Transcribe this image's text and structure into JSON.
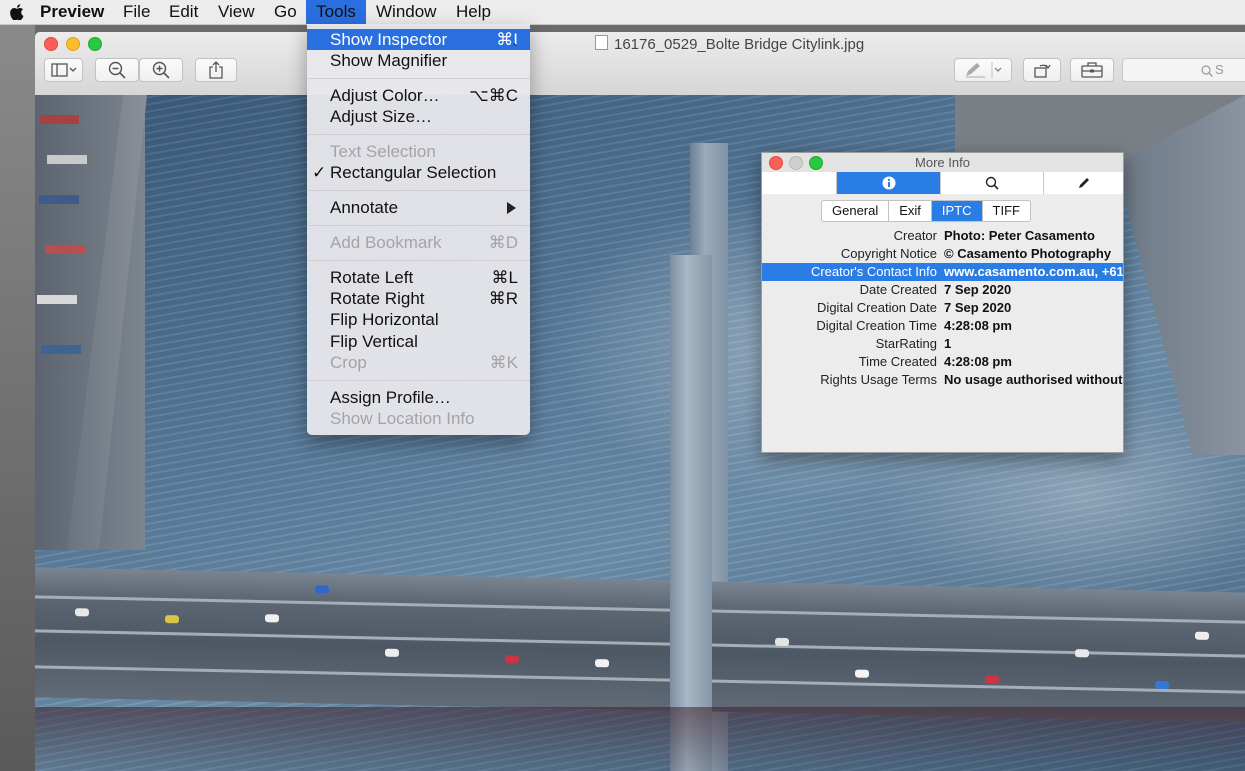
{
  "menubar": {
    "app": "Preview",
    "items": [
      "File",
      "Edit",
      "View",
      "Go",
      "Tools",
      "Window",
      "Help"
    ]
  },
  "window": {
    "title": "16176_0529_Bolte Bridge Citylink.jpg",
    "search_placeholder": "S"
  },
  "tools_menu": {
    "items": [
      {
        "label": "Show Inspector",
        "shortcut": "⌘I",
        "state": "highlighted"
      },
      {
        "label": "Show Magnifier",
        "shortcut": "`",
        "state": "enabled"
      },
      {
        "label": "Adjust Color…",
        "shortcut": "⌥⌘C",
        "state": "enabled"
      },
      {
        "label": "Adjust Size…",
        "shortcut": "",
        "state": "enabled"
      },
      {
        "label": "Text Selection",
        "shortcut": "",
        "state": "disabled"
      },
      {
        "label": "Rectangular Selection",
        "shortcut": "",
        "state": "checked"
      },
      {
        "label": "Annotate",
        "shortcut": "",
        "state": "submenu"
      },
      {
        "label": "Add Bookmark",
        "shortcut": "⌘D",
        "state": "disabled"
      },
      {
        "label": "Rotate Left",
        "shortcut": "⌘L",
        "state": "enabled"
      },
      {
        "label": "Rotate Right",
        "shortcut": "⌘R",
        "state": "enabled"
      },
      {
        "label": "Flip Horizontal",
        "shortcut": "",
        "state": "enabled"
      },
      {
        "label": "Flip Vertical",
        "shortcut": "",
        "state": "enabled"
      },
      {
        "label": "Crop",
        "shortcut": "⌘K",
        "state": "disabled"
      },
      {
        "label": "Assign Profile…",
        "shortcut": "",
        "state": "enabled"
      },
      {
        "label": "Show Location Info",
        "shortcut": "",
        "state": "disabled"
      }
    ],
    "checkmark": "✓"
  },
  "more_info": {
    "title": "More Info",
    "segments": [
      "info-icon",
      "search-icon",
      "pencil-icon"
    ],
    "tabs": [
      "General",
      "Exif",
      "IPTC",
      "TIFF"
    ],
    "active_tab": "IPTC",
    "rows": [
      {
        "key": "Creator",
        "value": "Photo: Peter Casamento"
      },
      {
        "key": "Copyright Notice",
        "value": "© Casamento Photography"
      },
      {
        "key": "Creator's Contact Info",
        "value": "www.casamento.com.au, +61"
      },
      {
        "key": "Date Created",
        "value": "7 Sep 2020"
      },
      {
        "key": "Digital Creation Date",
        "value": "7 Sep 2020"
      },
      {
        "key": "Digital Creation Time",
        "value": "4:28:08 pm"
      },
      {
        "key": "StarRating",
        "value": "1"
      },
      {
        "key": "Time Created",
        "value": "4:28:08 pm"
      },
      {
        "key": "Rights Usage Terms",
        "value": "No usage authorised without"
      }
    ],
    "selected_row": "Creator's Contact Info"
  },
  "colors": {
    "accent": "#2a6fe0",
    "close": "#fc5f57",
    "minimize": "#fdbc2e",
    "zoom": "#28c840"
  }
}
